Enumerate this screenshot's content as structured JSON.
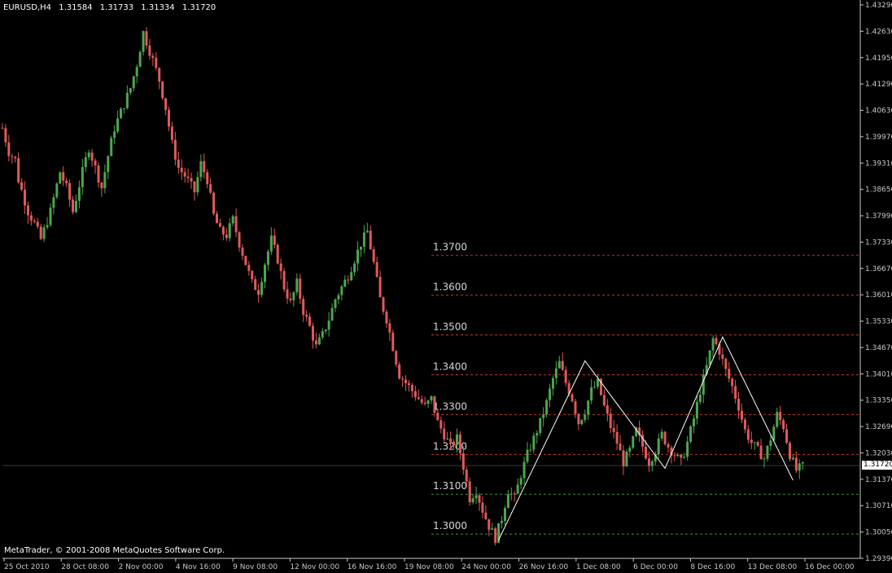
{
  "header": {
    "symbol": "EURUSD,H4",
    "values": [
      "1.31584",
      "1.31733",
      "1.31334",
      "1.31720"
    ]
  },
  "footer": {
    "copyright": "MetaTrader, © 2001-2008 MetaQuotes Software Corp."
  },
  "current_price": "1.31720",
  "colors": {
    "background": "#000000",
    "bull": "#4ea64e",
    "bear": "#e05a5a",
    "axis": "#c8c8c8",
    "grid": "#2a2a2a",
    "level_red": "#c0392b",
    "level_green": "#3f8f3f",
    "zigzag": "#ffffff"
  },
  "chart_data": {
    "type": "line",
    "title": "EURUSD,H4",
    "y_axis_ticks": [
      "1.43290",
      "1.42630",
      "1.41950",
      "1.41290",
      "1.40630",
      "1.39970",
      "1.39310",
      "1.38650",
      "1.37990",
      "1.37330",
      "1.36670",
      "1.36010",
      "1.35330",
      "1.34670",
      "1.34010",
      "1.33350",
      "1.32690",
      "1.32030",
      "1.31370",
      "1.30710",
      "1.30050",
      "1.29390"
    ],
    "ylim": [
      1.2939,
      1.4329
    ],
    "x_axis_ticks": [
      "25 Oct 2010",
      "28 Oct 08:00",
      "2 Nov 00:00",
      "4 Nov 16:00",
      "9 Nov 08:00",
      "12 Nov 00:00",
      "16 Nov 16:00",
      "19 Nov 08:00",
      "24 Nov 00:00",
      "26 Nov 16:00",
      "1 Dec 08:00",
      "6 Dec 00:00",
      "8 Dec 16:00",
      "13 Dec 08:00",
      "16 Dec 00:00"
    ],
    "price_path": [
      [
        0,
        1.402
      ],
      [
        2,
        1.396
      ],
      [
        4,
        1.394
      ],
      [
        5,
        1.389
      ],
      [
        8,
        1.381
      ],
      [
        10,
        1.378
      ],
      [
        12,
        1.374
      ],
      [
        15,
        1.381
      ],
      [
        18,
        1.391
      ],
      [
        20,
        1.387
      ],
      [
        22,
        1.381
      ],
      [
        25,
        1.391
      ],
      [
        27,
        1.397
      ],
      [
        29,
        1.392
      ],
      [
        31,
        1.387
      ],
      [
        33,
        1.395
      ],
      [
        35,
        1.402
      ],
      [
        37,
        1.406
      ],
      [
        40,
        1.412
      ],
      [
        42,
        1.418
      ],
      [
        44,
        1.426
      ],
      [
        47,
        1.419
      ],
      [
        49,
        1.414
      ],
      [
        51,
        1.407
      ],
      [
        53,
        1.398
      ],
      [
        55,
        1.392
      ],
      [
        57,
        1.39
      ],
      [
        60,
        1.386
      ],
      [
        62,
        1.393
      ],
      [
        64,
        1.389
      ],
      [
        66,
        1.38
      ],
      [
        68,
        1.376
      ],
      [
        70,
        1.375
      ],
      [
        72,
        1.379
      ],
      [
        74,
        1.373
      ],
      [
        76,
        1.368
      ],
      [
        78,
        1.363
      ],
      [
        80,
        1.361
      ],
      [
        82,
        1.368
      ],
      [
        84,
        1.374
      ],
      [
        86,
        1.369
      ],
      [
        88,
        1.362
      ],
      [
        90,
        1.358
      ],
      [
        92,
        1.363
      ],
      [
        94,
        1.356
      ],
      [
        96,
        1.352
      ],
      [
        98,
        1.347
      ],
      [
        100,
        1.35
      ],
      [
        102,
        1.354
      ],
      [
        104,
        1.359
      ],
      [
        106,
        1.362
      ],
      [
        108,
        1.365
      ],
      [
        110,
        1.369
      ],
      [
        112,
        1.373
      ],
      [
        114,
        1.376
      ],
      [
        116,
        1.368
      ],
      [
        118,
        1.359
      ],
      [
        120,
        1.354
      ],
      [
        122,
        1.347
      ],
      [
        124,
        1.34
      ],
      [
        126,
        1.338
      ],
      [
        128,
        1.336
      ],
      [
        130,
        1.334
      ],
      [
        132,
        1.332
      ],
      [
        134,
        1.334
      ],
      [
        136,
        1.328
      ],
      [
        138,
        1.325
      ],
      [
        140,
        1.322
      ],
      [
        142,
        1.324
      ],
      [
        144,
        1.317
      ],
      [
        146,
        1.309
      ],
      [
        148,
        1.311
      ],
      [
        150,
        1.306
      ],
      [
        152,
        1.302
      ],
      [
        154,
        1.299
      ],
      [
        156,
        1.304
      ],
      [
        158,
        1.311
      ],
      [
        160,
        1.309
      ],
      [
        162,
        1.315
      ],
      [
        164,
        1.32
      ],
      [
        166,
        1.324
      ],
      [
        168,
        1.328
      ],
      [
        170,
        1.333
      ],
      [
        172,
        1.339
      ],
      [
        174,
        1.343
      ],
      [
        176,
        1.338
      ],
      [
        178,
        1.334
      ],
      [
        180,
        1.328
      ],
      [
        182,
        1.331
      ],
      [
        184,
        1.336
      ],
      [
        186,
        1.338
      ],
      [
        188,
        1.332
      ],
      [
        190,
        1.327
      ],
      [
        192,
        1.323
      ],
      [
        194,
        1.318
      ],
      [
        196,
        1.321
      ],
      [
        198,
        1.326
      ],
      [
        200,
        1.322
      ],
      [
        202,
        1.318
      ],
      [
        204,
        1.321
      ],
      [
        206,
        1.325
      ],
      [
        208,
        1.322
      ],
      [
        210,
        1.32
      ],
      [
        212,
        1.318
      ],
      [
        214,
        1.323
      ],
      [
        216,
        1.329
      ],
      [
        218,
        1.336
      ],
      [
        220,
        1.342
      ],
      [
        222,
        1.349
      ],
      [
        224,
        1.346
      ],
      [
        226,
        1.341
      ],
      [
        228,
        1.337
      ],
      [
        230,
        1.332
      ],
      [
        232,
        1.326
      ],
      [
        234,
        1.323
      ],
      [
        236,
        1.321
      ],
      [
        238,
        1.319
      ],
      [
        240,
        1.324
      ],
      [
        242,
        1.33
      ],
      [
        244,
        1.327
      ],
      [
        246,
        1.32
      ],
      [
        248,
        1.316
      ],
      [
        250,
        1.317
      ]
    ],
    "x_range": [
      0,
      268
    ],
    "levels": [
      {
        "label": "1.3700",
        "value": 1.37,
        "color": "red"
      },
      {
        "label": "1.3600",
        "value": 1.36,
        "color": "red"
      },
      {
        "label": "1.3500",
        "value": 1.35,
        "color": "red"
      },
      {
        "label": "1.3400",
        "value": 1.34,
        "color": "red"
      },
      {
        "label": "1.3300",
        "value": 1.33,
        "color": "red"
      },
      {
        "label": "1.3200",
        "value": 1.32,
        "color": "red"
      },
      {
        "label": "1.3100",
        "value": 1.31,
        "color": "green"
      },
      {
        "label": "1.3000",
        "value": 1.3,
        "color": "green"
      }
    ],
    "levels_start_x": 134,
    "zigzag": [
      [
        155,
        1.2985
      ],
      [
        182,
        1.3435
      ],
      [
        207,
        1.3165
      ],
      [
        225,
        1.3495
      ],
      [
        247,
        1.3135
      ]
    ]
  }
}
